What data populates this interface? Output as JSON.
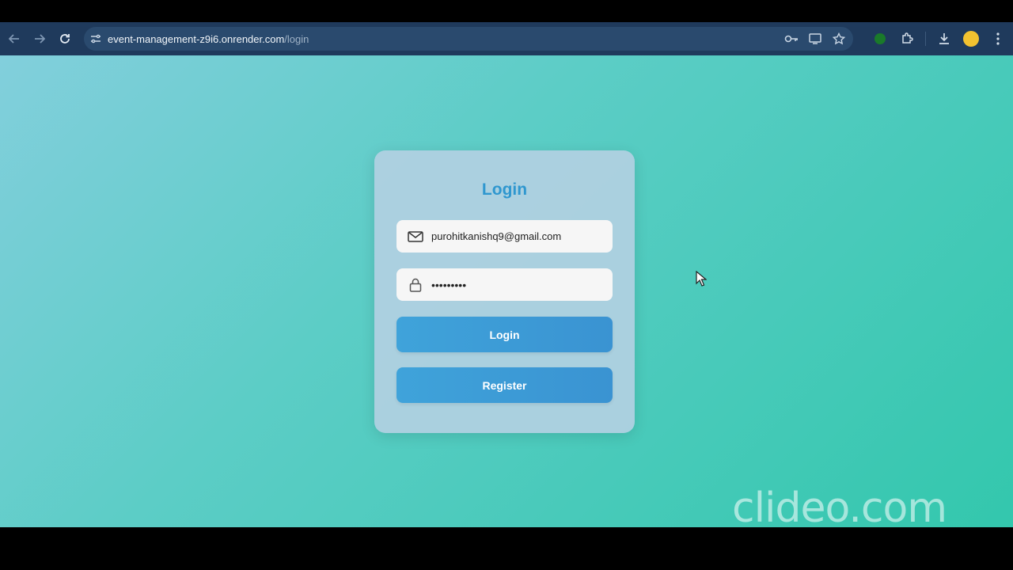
{
  "browser": {
    "url_host": "event-management-z9i6.onrender.com",
    "url_path": "/login"
  },
  "icons": {
    "back": "arrow-left-icon",
    "forward": "arrow-right-icon",
    "reload": "reload-icon",
    "site_info": "tune-icon",
    "password_key": "key-icon",
    "cast": "cast-icon",
    "bookmark": "star-icon",
    "extension": "puzzle-icon",
    "download": "download-icon",
    "menu": "kebab-menu-icon",
    "email": "mail-icon",
    "password": "lock-icon"
  },
  "login_card": {
    "title": "Login",
    "email_value": "purohitkanishq9@gmail.com",
    "password_value": "•••••••••",
    "login_label": "Login",
    "register_label": "Register"
  },
  "watermark": "clideo.com",
  "colors": {
    "accent": "#2f97cf",
    "button": "#3a9ad6",
    "toolbar": "#1f3a5c"
  }
}
